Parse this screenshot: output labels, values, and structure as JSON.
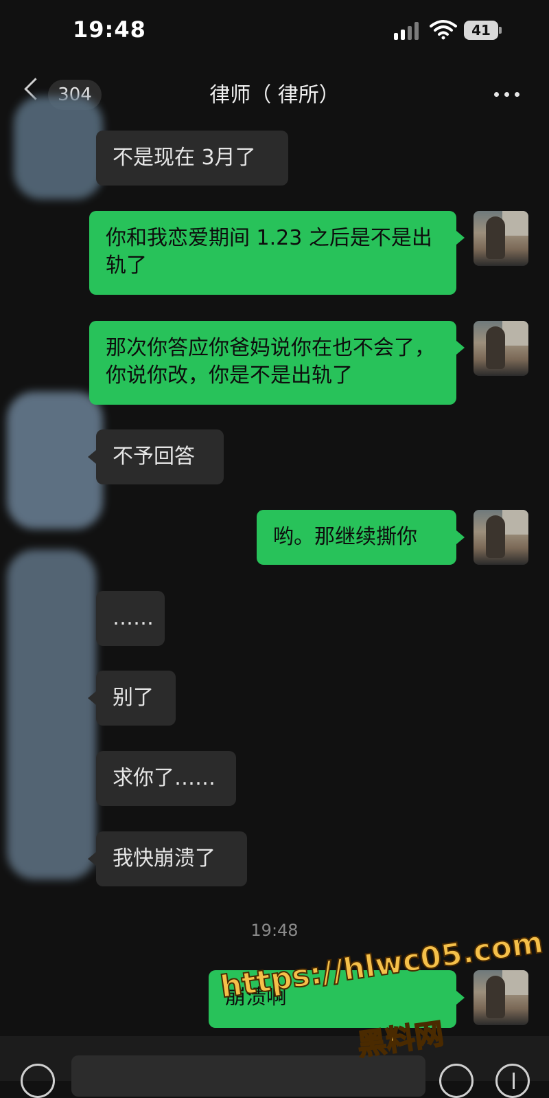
{
  "status_bar": {
    "time": "19:48",
    "battery": "41"
  },
  "nav": {
    "unread_count": "304",
    "title": "律师（ 律所）"
  },
  "messages": [
    {
      "dir": "in",
      "text": "不是现在 3月了"
    },
    {
      "dir": "out",
      "text": "你和我恋爱期间 1.23 之后是不是出轨了"
    },
    {
      "dir": "out",
      "text": "那次你答应你爸妈说你在也不会了，你说你改，你是不是出轨了"
    },
    {
      "dir": "in",
      "text": "不予回答"
    },
    {
      "dir": "out",
      "text": "哟。那继续撕你"
    },
    {
      "dir": "in",
      "text": "……"
    },
    {
      "dir": "in",
      "text": "别了"
    },
    {
      "dir": "in",
      "text": "求你了……"
    },
    {
      "dir": "in",
      "text": "我快崩溃了"
    },
    {
      "dir": "out",
      "text": "崩溃啊"
    }
  ],
  "divider_time": "19:48",
  "watermark": {
    "url": "https://hlwc05.com",
    "label": "黑料网"
  },
  "colors": {
    "background": "#111111",
    "incoming_bubble": "#2b2b2b",
    "outgoing_bubble": "#28c25a"
  },
  "icons": {
    "back": "chevron-left-icon",
    "more": "more-horizontal-icon",
    "voice": "voice-icon",
    "emoji": "emoji-icon",
    "plus": "plus-icon"
  }
}
